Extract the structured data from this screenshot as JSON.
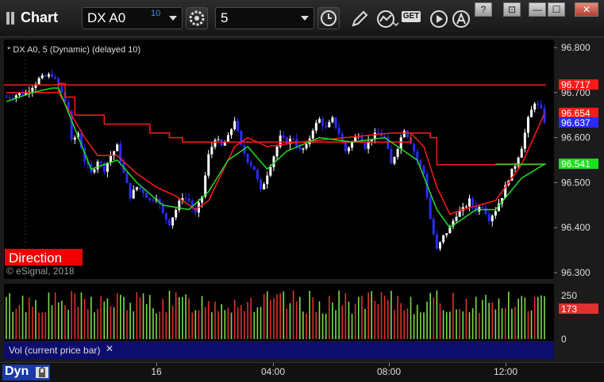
{
  "window": {
    "app_label": "Chart",
    "symbol": "DX A0",
    "symbol_badge": "10",
    "interval": "5",
    "get_label": "GET",
    "help": "?",
    "link": "⊡",
    "minimize": "—",
    "maximize": "☐",
    "close": "✕"
  },
  "chart_header": "* DX A0, 5 (Dynamic) (delayed 10)",
  "direction_label": "Direction",
  "copyright": "© eSignal, 2018",
  "volume_panel_label": "Vol (current price bar)",
  "volume_close": "✕",
  "status_bar": {
    "mode": "Dyn"
  },
  "colors": {
    "up": "#ffffff",
    "down": "#2b2bff",
    "red_line": "#ff1a1a",
    "green_line": "#22dd22",
    "vol_up": "#7ddc4c",
    "vol_down": "#e03030",
    "bg": "#000000"
  },
  "chart_data": {
    "type": "candlestick",
    "price_axis": {
      "ticks": [
        "96.800",
        "96.700",
        "96.600",
        "96.500",
        "96.400",
        "96.300"
      ],
      "ylim": [
        96.3,
        96.8
      ]
    },
    "price_labels": [
      {
        "value": 96.717,
        "text": "96.717",
        "color": "#ff1a1a"
      },
      {
        "value": 96.654,
        "text": "96.654",
        "color": "#ff1a1a"
      },
      {
        "value": 96.637,
        "text": "96.637",
        "color": "#2b2bff"
      },
      {
        "value": 96.541,
        "text": "96.541",
        "color": "#22dd22"
      }
    ],
    "horizontal_line": 96.717,
    "time_axis": [
      "16",
      "04:00",
      "08:00",
      "12:00"
    ],
    "volume_axis": {
      "ticks": [
        "250",
        "0"
      ],
      "ylim": [
        0,
        300
      ]
    },
    "volume_label": {
      "value": 173,
      "text": "173"
    },
    "close_path": [
      [
        0,
        96.69
      ],
      [
        6,
        96.7
      ],
      [
        10,
        96.73
      ],
      [
        14,
        96.74
      ],
      [
        17,
        96.7
      ],
      [
        19,
        96.66
      ],
      [
        20,
        96.59
      ],
      [
        22,
        96.61
      ],
      [
        24,
        96.55
      ],
      [
        26,
        96.52
      ],
      [
        28,
        96.55
      ],
      [
        30,
        96.53
      ],
      [
        32,
        96.56
      ],
      [
        34,
        96.58
      ],
      [
        36,
        96.52
      ],
      [
        38,
        96.47
      ],
      [
        40,
        96.49
      ],
      [
        42,
        96.48
      ],
      [
        44,
        96.46
      ],
      [
        46,
        96.47
      ],
      [
        48,
        96.43
      ],
      [
        50,
        96.41
      ],
      [
        52,
        96.44
      ],
      [
        54,
        96.47
      ],
      [
        56,
        96.46
      ],
      [
        58,
        96.43
      ],
      [
        60,
        96.47
      ],
      [
        62,
        96.56
      ],
      [
        64,
        96.6
      ],
      [
        66,
        96.58
      ],
      [
        68,
        96.6
      ],
      [
        70,
        96.64
      ],
      [
        72,
        96.58
      ],
      [
        74,
        96.55
      ],
      [
        76,
        96.53
      ],
      [
        78,
        96.48
      ],
      [
        80,
        96.52
      ],
      [
        82,
        96.56
      ],
      [
        84,
        96.6
      ],
      [
        86,
        96.59
      ],
      [
        88,
        96.6
      ],
      [
        90,
        96.57
      ],
      [
        92,
        96.58
      ],
      [
        94,
        96.62
      ],
      [
        96,
        96.64
      ],
      [
        98,
        96.62
      ],
      [
        100,
        96.64
      ],
      [
        102,
        96.61
      ],
      [
        104,
        96.57
      ],
      [
        106,
        96.59
      ],
      [
        108,
        96.61
      ],
      [
        110,
        96.58
      ],
      [
        112,
        96.6
      ],
      [
        114,
        96.61
      ],
      [
        116,
        96.6
      ],
      [
        118,
        96.54
      ],
      [
        120,
        96.58
      ],
      [
        122,
        96.62
      ],
      [
        124,
        96.59
      ],
      [
        126,
        96.55
      ],
      [
        128,
        96.52
      ],
      [
        130,
        96.42
      ],
      [
        132,
        96.35
      ],
      [
        134,
        96.38
      ],
      [
        136,
        96.4
      ],
      [
        138,
        96.43
      ],
      [
        140,
        96.44
      ],
      [
        142,
        96.46
      ],
      [
        144,
        96.44
      ],
      [
        146,
        96.45
      ],
      [
        148,
        96.42
      ],
      [
        150,
        96.44
      ],
      [
        152,
        96.47
      ],
      [
        154,
        96.51
      ],
      [
        156,
        96.54
      ],
      [
        158,
        96.58
      ],
      [
        160,
        96.64
      ],
      [
        162,
        96.68
      ],
      [
        164,
        96.66
      ],
      [
        165,
        96.637
      ]
    ],
    "red_line": [
      [
        0,
        96.7
      ],
      [
        16,
        96.72
      ],
      [
        18,
        96.69
      ],
      [
        21,
        96.65
      ],
      [
        22,
        96.65
      ],
      [
        30,
        96.63
      ],
      [
        40,
        96.63
      ],
      [
        44,
        96.61
      ],
      [
        50,
        96.6
      ],
      [
        54,
        96.59
      ],
      [
        98,
        96.59
      ],
      [
        120,
        96.59
      ],
      [
        124,
        96.61
      ],
      [
        130,
        96.6
      ],
      [
        132,
        96.54
      ],
      [
        165,
        96.54
      ]
    ],
    "red_curve": [
      [
        16,
        96.7
      ],
      [
        20,
        96.65
      ],
      [
        24,
        96.6
      ],
      [
        28,
        96.56
      ],
      [
        34,
        96.56
      ],
      [
        40,
        96.52
      ],
      [
        46,
        96.49
      ],
      [
        52,
        96.47
      ],
      [
        58,
        96.44
      ],
      [
        62,
        96.46
      ],
      [
        66,
        96.52
      ],
      [
        70,
        96.58
      ],
      [
        74,
        96.6
      ],
      [
        80,
        96.58
      ],
      [
        90,
        96.59
      ],
      [
        118,
        96.61
      ],
      [
        124,
        96.61
      ],
      [
        128,
        96.58
      ],
      [
        132,
        96.49
      ],
      [
        136,
        96.43
      ],
      [
        140,
        96.44
      ],
      [
        150,
        96.46
      ],
      [
        158,
        96.54
      ],
      [
        165,
        96.654
      ]
    ],
    "green_curve": [
      [
        0,
        96.68
      ],
      [
        8,
        96.7
      ],
      [
        14,
        96.71
      ],
      [
        16,
        96.71
      ],
      [
        26,
        96.53
      ],
      [
        34,
        96.55
      ],
      [
        40,
        96.5
      ],
      [
        48,
        96.45
      ],
      [
        56,
        96.44
      ],
      [
        62,
        96.48
      ],
      [
        68,
        96.55
      ],
      [
        74,
        96.58
      ],
      [
        80,
        96.53
      ],
      [
        86,
        96.57
      ],
      [
        96,
        96.6
      ],
      [
        106,
        96.59
      ],
      [
        116,
        96.6
      ],
      [
        126,
        96.55
      ],
      [
        132,
        96.44
      ],
      [
        136,
        96.4
      ],
      [
        144,
        96.44
      ],
      [
        150,
        96.44
      ],
      [
        158,
        96.51
      ],
      [
        165,
        96.541
      ]
    ]
  }
}
